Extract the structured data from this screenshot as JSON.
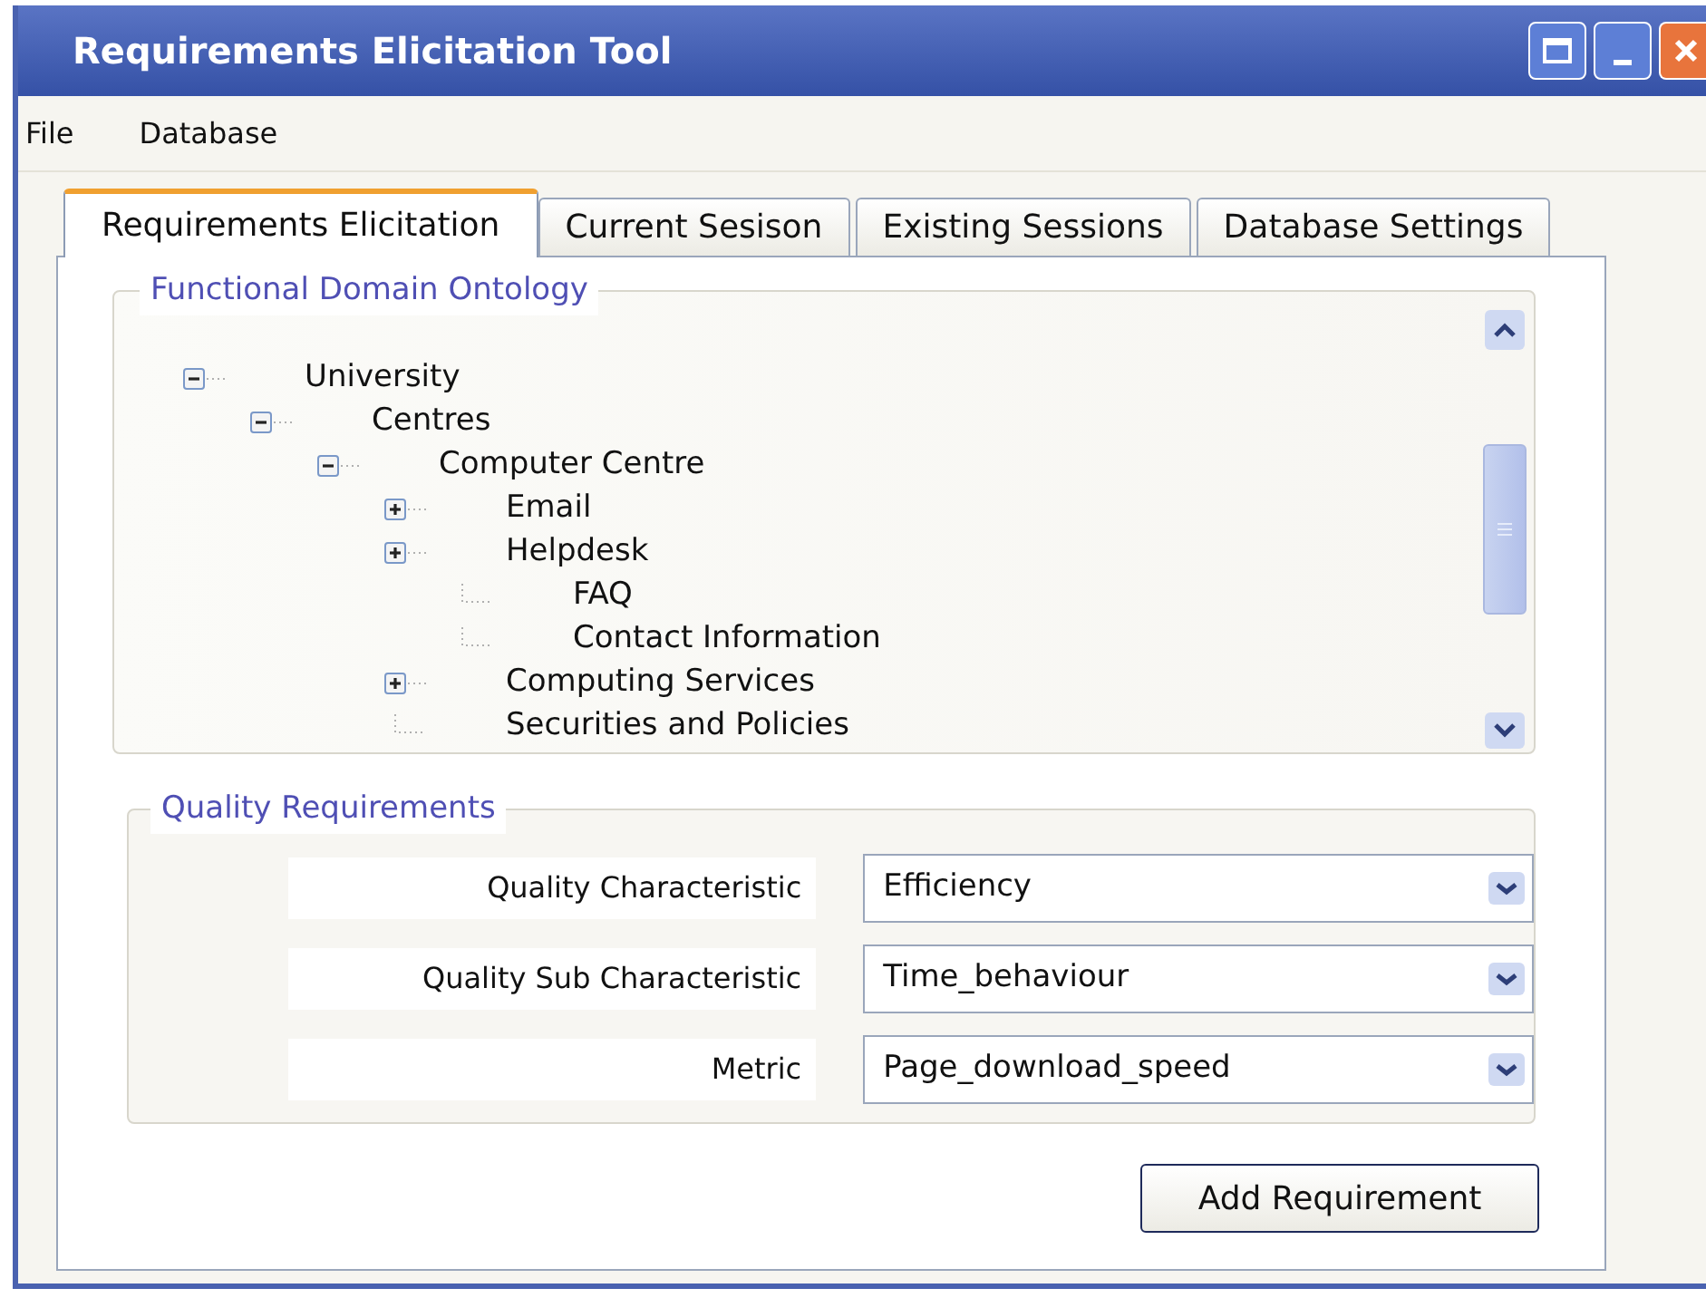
{
  "window": {
    "title": "Requirements Elicitation Tool"
  },
  "menu": [
    "File",
    "Database"
  ],
  "tabs": [
    {
      "label": "Requirements Elicitation",
      "selected": true
    },
    {
      "label": "Current Sesison",
      "selected": false
    },
    {
      "label": "Existing Sessions",
      "selected": false
    },
    {
      "label": "Database Settings",
      "selected": false
    }
  ],
  "ontology": {
    "title": "Functional Domain Ontology",
    "tree": [
      {
        "label": "University",
        "kind": "expanded",
        "children": [
          {
            "label": "Centres",
            "kind": "expanded",
            "children": [
              {
                "label": "Computer Centre",
                "kind": "expanded",
                "children": [
                  {
                    "label": "Email",
                    "kind": "collapsed"
                  },
                  {
                    "label": "Helpdesk",
                    "kind": "collapsed",
                    "children": [
                      {
                        "label": "FAQ",
                        "kind": "leaf"
                      },
                      {
                        "label": "Contact Information",
                        "kind": "leaf"
                      }
                    ]
                  },
                  {
                    "label": "Computing Services",
                    "kind": "collapsed"
                  },
                  {
                    "label": "Securities and Policies",
                    "kind": "leaf"
                  }
                ]
              }
            ]
          }
        ]
      }
    ]
  },
  "quality": {
    "title": "Quality Requirements",
    "fields": [
      {
        "label": "Quality Characteristic",
        "value": "Efficiency"
      },
      {
        "label": "Quality Sub Characteristic",
        "value": "Time_behaviour"
      },
      {
        "label": "Metric",
        "value": "Page_download_speed"
      }
    ]
  },
  "buttons": [
    "Add Requirement"
  ]
}
